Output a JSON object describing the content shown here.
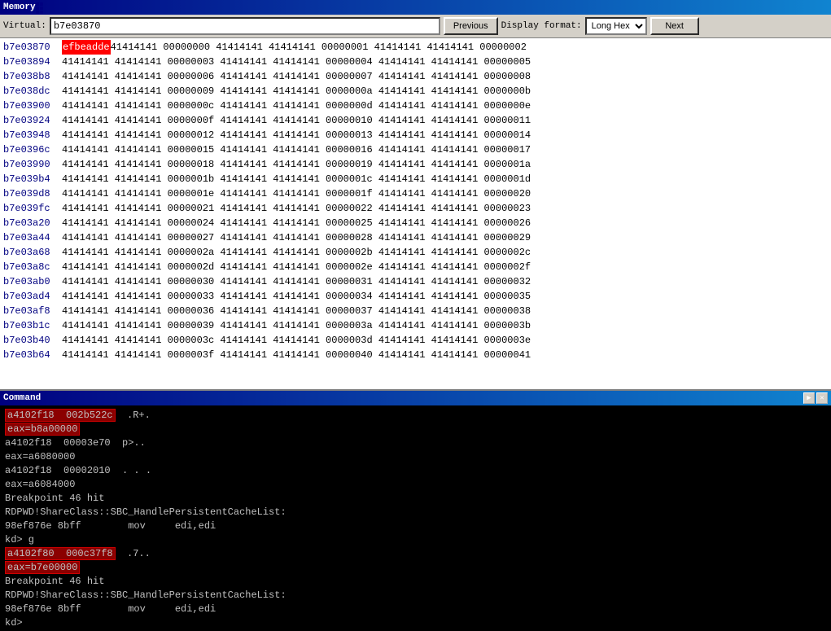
{
  "memory": {
    "title": "Memory",
    "virtual_label": "Virtual:",
    "virtual_value": "b7e03870",
    "previous_btn": "Previous",
    "display_format_label": "Display format:",
    "display_format_value": "Long Hex",
    "next_btn": "Next",
    "rows": [
      {
        "addr": "b7e03870",
        "highlight": "efbeadde",
        "values": " 41414141  00000000  41414141  41414141  00000001  41414141  41414141  00000002"
      },
      {
        "addr": "b7e03894",
        "highlight": null,
        "values": " 41414141  41414141  00000003  41414141  41414141  00000004  41414141  41414141  00000005"
      },
      {
        "addr": "b7e038b8",
        "highlight": null,
        "values": " 41414141  41414141  00000006  41414141  41414141  00000007  41414141  41414141  00000008"
      },
      {
        "addr": "b7e038dc",
        "highlight": null,
        "values": " 41414141  41414141  00000009  41414141  41414141  0000000a  41414141  41414141  0000000b"
      },
      {
        "addr": "b7e03900",
        "highlight": null,
        "values": " 41414141  41414141  0000000c  41414141  41414141  0000000d  41414141  41414141  0000000e"
      },
      {
        "addr": "b7e03924",
        "highlight": null,
        "values": " 41414141  41414141  0000000f  41414141  41414141  00000010  41414141  41414141  00000011"
      },
      {
        "addr": "b7e03948",
        "highlight": null,
        "values": " 41414141  41414141  00000012  41414141  41414141  00000013  41414141  41414141  00000014"
      },
      {
        "addr": "b7e0396c",
        "highlight": null,
        "values": " 41414141  41414141  00000015  41414141  41414141  00000016  41414141  41414141  00000017"
      },
      {
        "addr": "b7e03990",
        "highlight": null,
        "values": " 41414141  41414141  00000018  41414141  41414141  00000019  41414141  41414141  0000001a"
      },
      {
        "addr": "b7e039b4",
        "highlight": null,
        "values": " 41414141  41414141  0000001b  41414141  41414141  0000001c  41414141  41414141  0000001d"
      },
      {
        "addr": "b7e039d8",
        "highlight": null,
        "values": " 41414141  41414141  0000001e  41414141  41414141  0000001f  41414141  41414141  00000020"
      },
      {
        "addr": "b7e039fc",
        "highlight": null,
        "values": " 41414141  41414141  00000021  41414141  41414141  00000022  41414141  41414141  00000023"
      },
      {
        "addr": "b7e03a20",
        "highlight": null,
        "values": " 41414141  41414141  00000024  41414141  41414141  00000025  41414141  41414141  00000026"
      },
      {
        "addr": "b7e03a44",
        "highlight": null,
        "values": " 41414141  41414141  00000027  41414141  41414141  00000028  41414141  41414141  00000029"
      },
      {
        "addr": "b7e03a68",
        "highlight": null,
        "values": " 41414141  41414141  0000002a  41414141  41414141  0000002b  41414141  41414141  0000002c"
      },
      {
        "addr": "b7e03a8c",
        "highlight": null,
        "values": " 41414141  41414141  0000002d  41414141  41414141  0000002e  41414141  41414141  0000002f"
      },
      {
        "addr": "b7e03ab0",
        "highlight": null,
        "values": " 41414141  41414141  00000030  41414141  41414141  00000031  41414141  41414141  00000032"
      },
      {
        "addr": "b7e03ad4",
        "highlight": null,
        "values": " 41414141  41414141  00000033  41414141  41414141  00000034  41414141  41414141  00000035"
      },
      {
        "addr": "b7e03af8",
        "highlight": null,
        "values": " 41414141  41414141  00000036  41414141  41414141  00000037  41414141  41414141  00000038"
      },
      {
        "addr": "b7e03b1c",
        "highlight": null,
        "values": " 41414141  41414141  00000039  41414141  41414141  0000003a  41414141  41414141  0000003b"
      },
      {
        "addr": "b7e03b40",
        "highlight": null,
        "values": " 41414141  41414141  0000003c  41414141  41414141  0000003d  41414141  41414141  0000003e"
      },
      {
        "addr": "b7e03b64",
        "highlight": null,
        "values": " 41414141  41414141  0000003f  41414141  41414141  00000040  41414141  41414141  00000041"
      }
    ]
  },
  "command": {
    "title": "Command",
    "lines": [
      {
        "text": "a4102f18  002b522c",
        "highlight": true,
        "suffix": "  .R+."
      },
      {
        "text": "eax=b8a00000",
        "highlight": true,
        "suffix": ""
      },
      {
        "text": "a4102f18  00003e70",
        "highlight": false,
        "suffix": "  p>.."
      },
      {
        "text": "eax=a6080000",
        "highlight": false,
        "suffix": ""
      },
      {
        "text": "a4102f18  00002010",
        "highlight": false,
        "suffix": "  . . ."
      },
      {
        "text": "eax=a6084000",
        "highlight": false,
        "suffix": ""
      },
      {
        "text": "Breakpoint 46 hit",
        "highlight": false,
        "suffix": ""
      },
      {
        "text": "RDPWD!ShareClass::SBC_HandlePersistentCacheList:",
        "highlight": false,
        "suffix": ""
      },
      {
        "text": "98ef876e 8bff        mov     edi,edi",
        "highlight": false,
        "suffix": ""
      },
      {
        "text": "kd> g",
        "highlight": false,
        "suffix": ""
      },
      {
        "text": "a4102f80  000c37f8",
        "highlight": true,
        "suffix": "  .7.."
      },
      {
        "text": "eax=b7e00000",
        "highlight": true,
        "suffix": ""
      },
      {
        "text": "Breakpoint 46 hit",
        "highlight": false,
        "suffix": ""
      },
      {
        "text": "RDPWD!ShareClass::SBC_HandlePersistentCacheList:",
        "highlight": false,
        "suffix": ""
      },
      {
        "text": "98ef876e 8bff        mov     edi,edi",
        "highlight": false,
        "suffix": ""
      },
      {
        "text": "kd>",
        "highlight": false,
        "suffix": ""
      }
    ]
  }
}
